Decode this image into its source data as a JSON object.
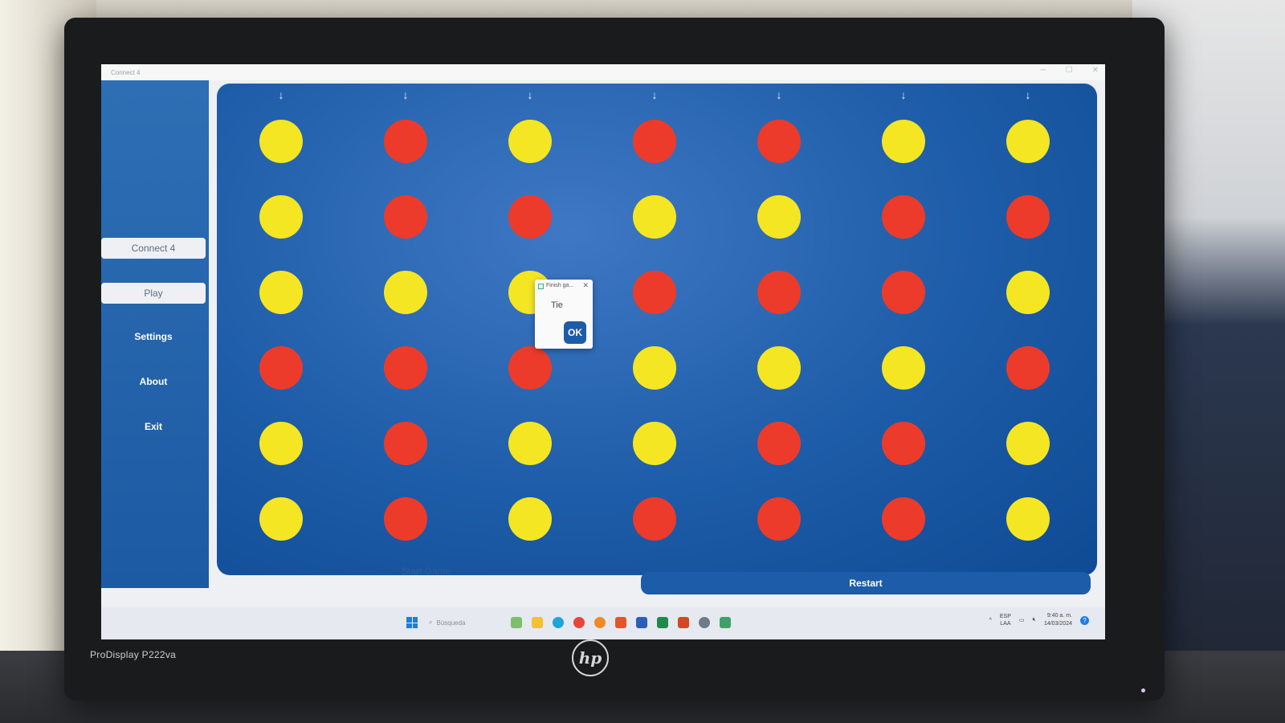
{
  "window": {
    "title": "Connect 4"
  },
  "sidebar": {
    "items": [
      {
        "label": "Connect 4",
        "style": "light"
      },
      {
        "label": "Play",
        "style": "light"
      },
      {
        "label": "Settings",
        "style": "dark"
      },
      {
        "label": "About",
        "style": "dark"
      },
      {
        "label": "Exit",
        "style": "dark"
      }
    ]
  },
  "board": {
    "columns": 7,
    "rows": 6,
    "drop_arrow": "↓",
    "grid": [
      [
        "yellow",
        "red",
        "yellow",
        "red",
        "red",
        "yellow",
        "yellow"
      ],
      [
        "yellow",
        "red",
        "red",
        "yellow",
        "yellow",
        "red",
        "red"
      ],
      [
        "yellow",
        "yellow",
        "yellow",
        "red",
        "red",
        "red",
        "yellow"
      ],
      [
        "red",
        "red",
        "red",
        "yellow",
        "yellow",
        "yellow",
        "red"
      ],
      [
        "yellow",
        "red",
        "yellow",
        "yellow",
        "red",
        "red",
        "yellow"
      ],
      [
        "yellow",
        "red",
        "yellow",
        "red",
        "red",
        "red",
        "yellow"
      ]
    ],
    "colors": {
      "yellow": "#f4e623",
      "red": "#ec3b2a",
      "board": "#1d5ca8"
    }
  },
  "dialog": {
    "title": "Finish ga...",
    "message": "Tie",
    "ok_label": "OK"
  },
  "controls": {
    "start_label": "Start Game",
    "restart_label": "Restart"
  },
  "taskbar": {
    "search_placeholder": "Búsqueda",
    "lang_top": "ESP",
    "lang_bottom": "LAA",
    "time": "9:40 a. m.",
    "date": "14/03/2024",
    "help": "?"
  },
  "monitor": {
    "model": "ProDisplay P222va",
    "brand": "hp"
  }
}
